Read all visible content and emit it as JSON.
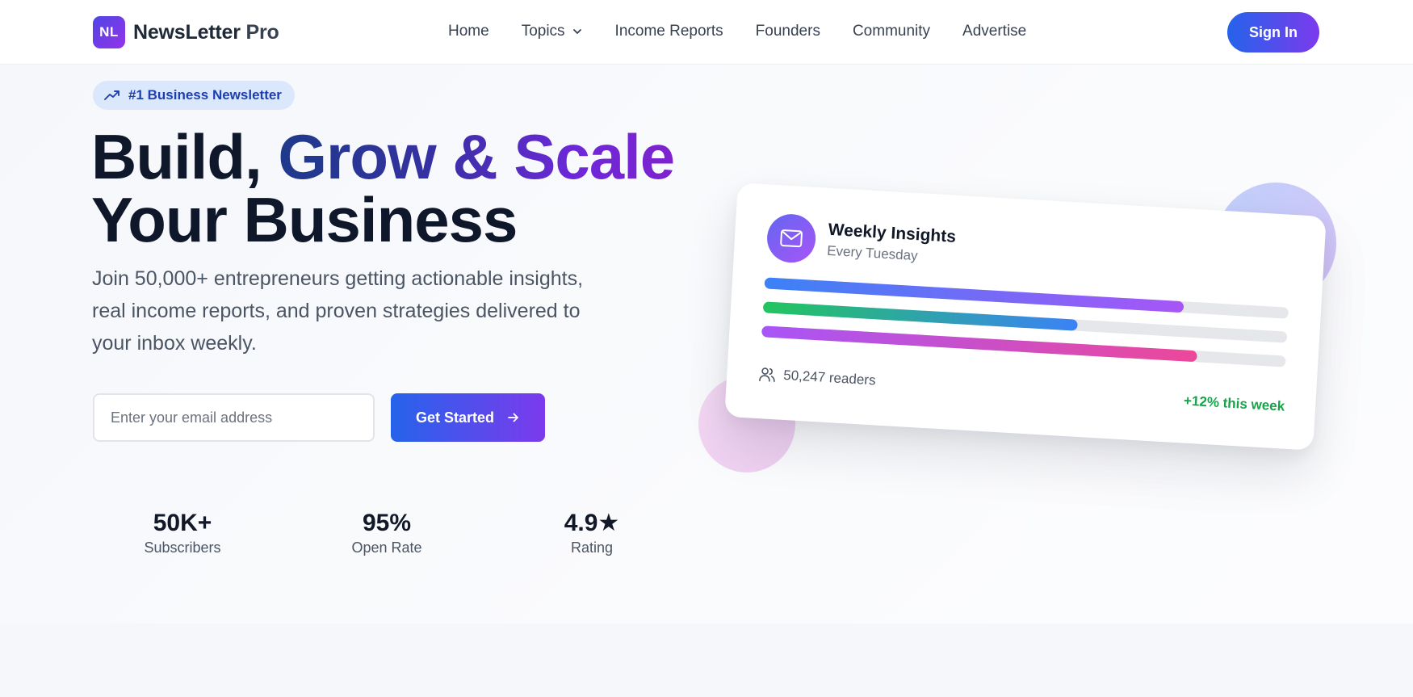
{
  "brand": {
    "mark": "NL",
    "name": "NewsLetter",
    "suffix": "Pro"
  },
  "nav": {
    "links": [
      {
        "label": "Home"
      },
      {
        "label": "Topics",
        "has_dropdown": true
      },
      {
        "label": "Income Reports"
      },
      {
        "label": "Founders"
      },
      {
        "label": "Community"
      },
      {
        "label": "Advertise"
      }
    ],
    "signin_label": "Sign In"
  },
  "hero": {
    "badge_icon": "trending-up-icon",
    "badge": "#1 Business Newsletter",
    "headline_part1": "Build, ",
    "headline_gradient": "Grow & Scale",
    "headline_line2": "Your Business",
    "subtext": "Join 50,000+ entrepreneurs getting actionable insights, real income reports, and proven strategies delivered to your inbox weekly.",
    "email_placeholder": "Enter your email address",
    "email_value": "",
    "cta_label": "Get Started",
    "cta_icon": "arrow-right-icon"
  },
  "stats": [
    {
      "value": "50K+",
      "label": "Subscribers"
    },
    {
      "value": "95%",
      "label": "Open Rate"
    },
    {
      "value": "4.9★",
      "label": "Rating"
    }
  ],
  "card": {
    "icon": "mail-icon",
    "title": "Weekly Insights",
    "subtitle": "Every Tuesday",
    "bars": [
      {
        "fill_fraction": 0.8,
        "colors": [
          "#3b82f6",
          "#a855f7"
        ]
      },
      {
        "fill_fraction": 0.6,
        "colors": [
          "#22c55e",
          "#3b82f6"
        ]
      },
      {
        "fill_fraction": 0.83,
        "colors": [
          "#a855f7",
          "#ec4899"
        ]
      }
    ],
    "readers_icon": "users-icon",
    "readers": "50,247 readers",
    "growth": "+12% this week"
  },
  "colors": {
    "primary_gradient_start": "#2563eb",
    "primary_gradient_end": "#7c3aed",
    "success": "#16a34a",
    "badge_bg": "#dbe7fb",
    "badge_text": "#1e40af"
  }
}
